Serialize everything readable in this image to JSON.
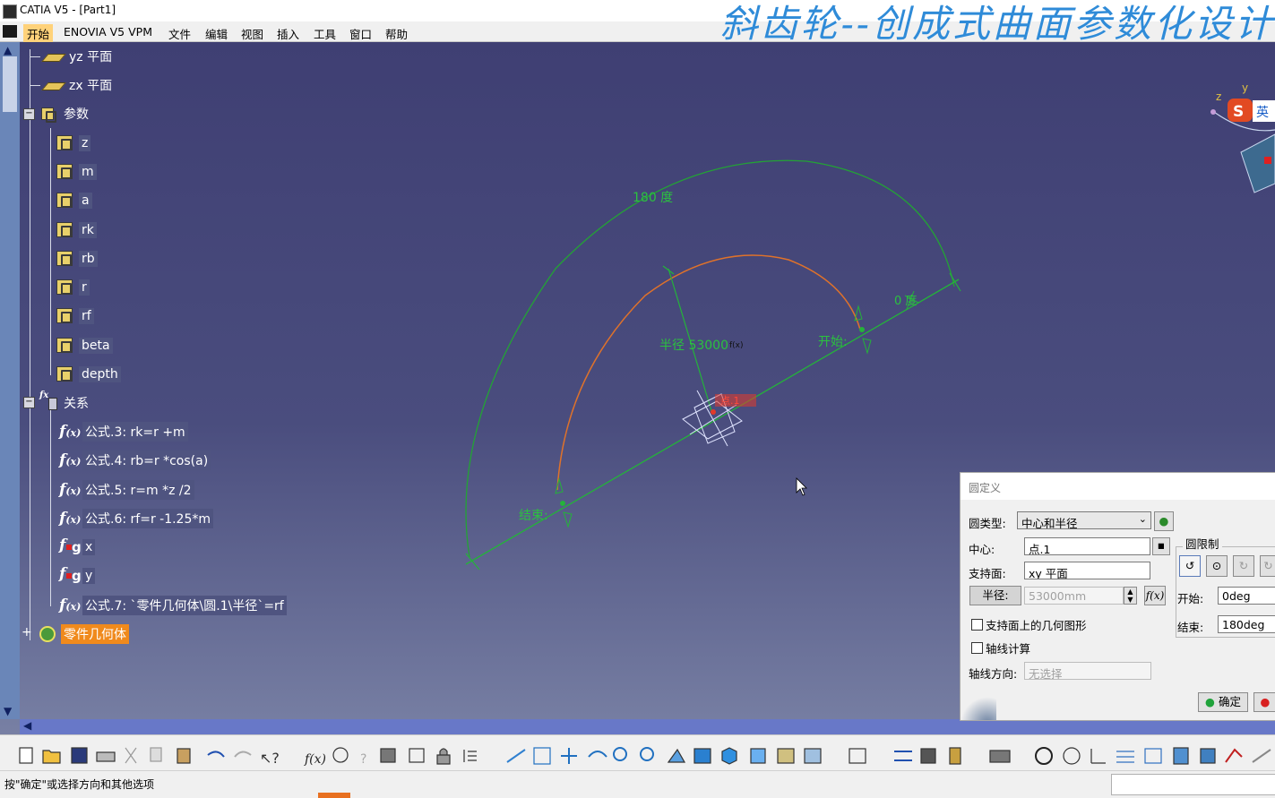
{
  "window": {
    "title": "CATIA V5 - [Part1]"
  },
  "overlay_title": "斜齿轮--创成式曲面参数化设计",
  "menu": [
    "开始",
    "ENOVIA V5 VPM",
    "文件",
    "编辑",
    "视图",
    "插入",
    "工具",
    "窗口",
    "帮助"
  ],
  "tree": {
    "planes": [
      "yz 平面",
      "zx 平面"
    ],
    "parameters_label": "参数",
    "parameters": [
      "z",
      "m",
      "a",
      "rk",
      "rb",
      "r",
      "rf",
      "beta",
      "depth"
    ],
    "relations_label": "关系",
    "relations": [
      "公式.3: rk=r +m",
      "公式.4: rb=r *cos(a)",
      "公式.5: r=m *z /2",
      "公式.6: rf=r -1.25*m",
      "x",
      "y",
      "公式.7: `零件几何体\\圆.1\\半径`=rf"
    ],
    "body_label": "零件几何体"
  },
  "canvas": {
    "arc_label": "180 度",
    "zero_label": "0 度",
    "radius_label": "半径 53000",
    "fx_label": "f(x)",
    "start_label": "开始:",
    "end_label": "结束:",
    "center_label": "点.1",
    "compass_x": "z",
    "compass_y": "y",
    "ime_label": "英",
    "colors": {
      "outer_arc": "#23a335",
      "inner_arc": "#e0722a",
      "axis": "#24b33a",
      "center": "#e23a2a"
    }
  },
  "dialog": {
    "title": "圆定义",
    "circle_type_label": "圆类型:",
    "circle_type_value": "中心和半径",
    "center_label": "中心:",
    "center_value": "点.1",
    "support_label": "支持面:",
    "support_value": "xy 平面",
    "radius_button": "半径:",
    "radius_value": "53000mm",
    "geometry_on_support": "支持面上的几何图形",
    "axis_computation": "轴线计算",
    "axis_direction_label": "轴线方向:",
    "axis_direction_value": "无选择",
    "limits_group": "圆限制",
    "start_label": "开始:",
    "start_value": "0deg",
    "end_label": "结束:",
    "end_value": "180deg",
    "ok_button": "确定"
  },
  "status": {
    "text": "按\"确定\"或选择方向和其他选项"
  }
}
